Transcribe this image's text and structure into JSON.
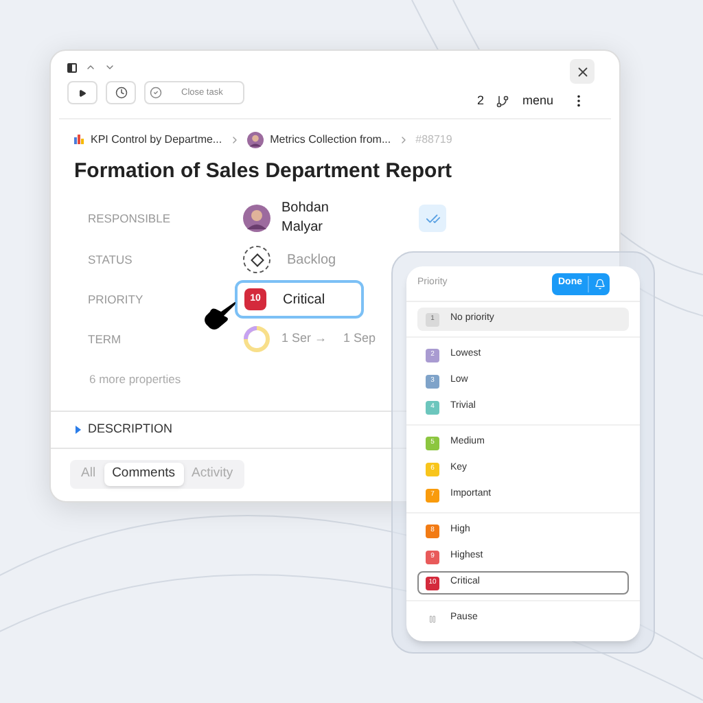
{
  "toolbar": {
    "close_task": "Close task",
    "count": "2",
    "menu": "menu"
  },
  "breadcrumb": [
    {
      "kind": "chart",
      "label": "KPI Control by Departme..."
    },
    {
      "kind": "avatar",
      "label": "Metrics Collection from..."
    },
    {
      "kind": "id",
      "label": "#88719"
    }
  ],
  "title": "Formation of Sales Department Report",
  "properties": [
    {
      "label": "RESPONSIBLE",
      "kind": "person",
      "value": "Bohdan Malyar"
    },
    {
      "label": "STATUS",
      "kind": "status",
      "value": "Backlog"
    },
    {
      "label": "PRIORITY",
      "kind": "priority",
      "number": "10",
      "value": "Critical",
      "color": "#d42a3c"
    },
    {
      "label": "TERM",
      "kind": "term",
      "start": "1 Ser →",
      "end": "1 Sep"
    }
  ],
  "more_properties": "6 more properties",
  "description": {
    "label": "DESCRIPTION",
    "expanded": false
  },
  "tabs": [
    {
      "label": "All",
      "selected": false
    },
    {
      "label": "Comments",
      "selected": true
    },
    {
      "label": "Activity",
      "selected": false
    }
  ],
  "priority_menu": {
    "title": "Priority",
    "done": "Done",
    "groups": [
      [
        {
          "kind": "level",
          "number": "1",
          "label": "No priority",
          "color": "#d9d9d9",
          "hovered": true,
          "selected": false
        }
      ],
      [
        {
          "kind": "level",
          "number": "2",
          "label": "Lowest",
          "color": "#a99bd1",
          "hovered": false,
          "selected": false
        },
        {
          "kind": "level",
          "number": "3",
          "label": "Low",
          "color": "#7fa3c9",
          "hovered": false,
          "selected": false
        },
        {
          "kind": "level",
          "number": "4",
          "label": "Trivial",
          "color": "#6cc6bd",
          "hovered": false,
          "selected": false
        }
      ],
      [
        {
          "kind": "level",
          "number": "5",
          "label": "Medium",
          "color": "#8cc63f",
          "hovered": false,
          "selected": false
        },
        {
          "kind": "level",
          "number": "6",
          "label": "Key",
          "color": "#f8c51c",
          "hovered": false,
          "selected": false
        },
        {
          "kind": "level",
          "number": "7",
          "label": "Important",
          "color": "#f99b0c",
          "hovered": false,
          "selected": false
        }
      ],
      [
        {
          "kind": "level",
          "number": "8",
          "label": "High",
          "color": "#f27b14",
          "hovered": false,
          "selected": false
        },
        {
          "kind": "level",
          "number": "9",
          "label": "Highest",
          "color": "#e85a5a",
          "hovered": false,
          "selected": false
        },
        {
          "kind": "level",
          "number": "10",
          "label": "Critical",
          "color": "#d42a3c",
          "hovered": false,
          "selected": true
        }
      ],
      [
        {
          "kind": "pause",
          "label": "Pause",
          "hovered": false,
          "selected": false
        }
      ]
    ]
  }
}
